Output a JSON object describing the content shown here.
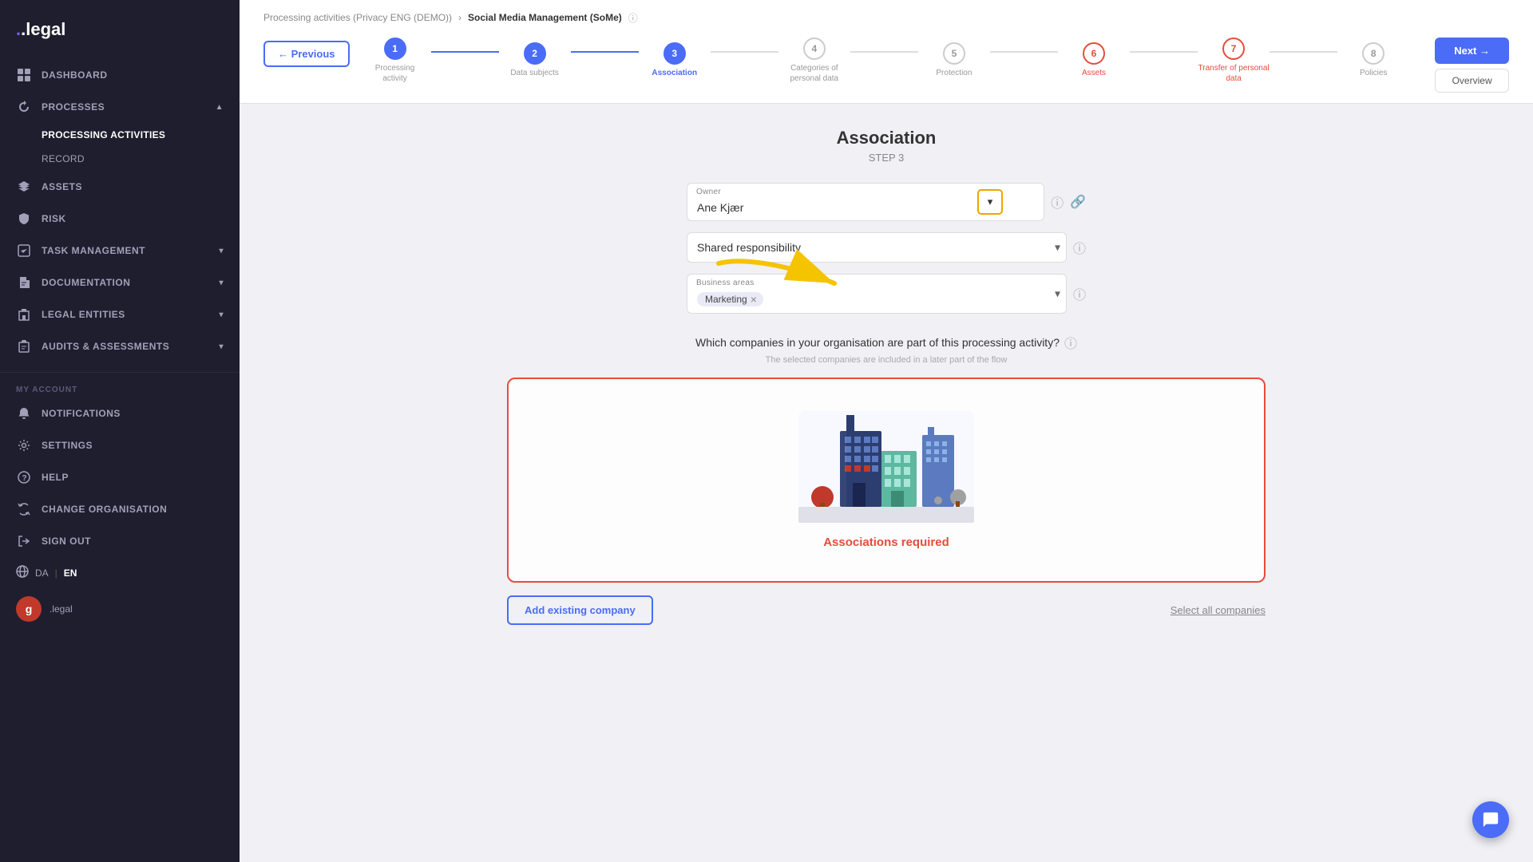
{
  "app": {
    "logo": ".legal",
    "logo_dot": "."
  },
  "sidebar": {
    "nav_items": [
      {
        "id": "dashboard",
        "label": "DASHBOARD",
        "icon": "grid"
      },
      {
        "id": "processes",
        "label": "PROCESSES",
        "icon": "refresh",
        "expanded": true
      },
      {
        "id": "processing-activities",
        "label": "PROCESSING ACTIVITIES",
        "active": true,
        "sub": true
      },
      {
        "id": "record",
        "label": "RECORD",
        "sub": true
      },
      {
        "id": "assets",
        "label": "ASSETS",
        "icon": "layers"
      },
      {
        "id": "risk",
        "label": "RISK",
        "icon": "shield"
      },
      {
        "id": "task-management",
        "label": "TASK MANAGEMENT",
        "icon": "check-square"
      },
      {
        "id": "documentation",
        "label": "DOCUMENTATION",
        "icon": "file-text"
      },
      {
        "id": "legal-entities",
        "label": "LEGAL ENTITIES",
        "icon": "building"
      },
      {
        "id": "audits-assessments",
        "label": "AUDITS & ASSESSMENTS",
        "icon": "clipboard"
      }
    ],
    "my_account_label": "MY ACCOUNT",
    "account_items": [
      {
        "id": "notifications",
        "label": "NOTIFICATIONS",
        "icon": "bell"
      },
      {
        "id": "settings",
        "label": "SETTINGS",
        "icon": "settings"
      },
      {
        "id": "help",
        "label": "HELP",
        "icon": "help-circle"
      },
      {
        "id": "change-organisation",
        "label": "CHANGE ORGANISATION",
        "icon": "refresh-cw"
      },
      {
        "id": "sign-out",
        "label": "SIGN OUT",
        "icon": "log-out"
      }
    ],
    "languages": [
      "DA",
      "EN"
    ],
    "active_lang": "EN",
    "avatar_letter": "g",
    "avatar_brand": ".legal"
  },
  "breadcrumb": {
    "parent": "Processing activities (Privacy ENG (DEMO))",
    "current": "Social Media Management (SoMe)",
    "info_icon": "ⓘ"
  },
  "steps": [
    {
      "num": "1",
      "label": "Processing activity",
      "state": "completed"
    },
    {
      "num": "2",
      "label": "Data subjects",
      "state": "completed"
    },
    {
      "num": "3",
      "label": "Association",
      "state": "active"
    },
    {
      "num": "4",
      "label": "Categories of personal data",
      "state": "default"
    },
    {
      "num": "5",
      "label": "Protection",
      "state": "default"
    },
    {
      "num": "6",
      "label": "Assets",
      "state": "warning"
    },
    {
      "num": "7",
      "label": "Transfer of personal data",
      "state": "warning"
    },
    {
      "num": "8",
      "label": "Policies",
      "state": "default"
    }
  ],
  "nav_buttons": {
    "prev": "← Previous",
    "next": "Next →",
    "overview": "Overview"
  },
  "page": {
    "title": "Association",
    "subtitle": "STEP 3"
  },
  "form": {
    "owner_label": "Owner",
    "owner_value": "Ane Kjær",
    "shared_responsibility_label": "Shared responsibility",
    "shared_responsibility_placeholder": "Shared responsibility",
    "business_areas_label": "Business areas",
    "business_areas_tag": "Marketing",
    "dropdown_icon": "▾",
    "info_icon": "ⓘ",
    "link_icon": "🔗"
  },
  "question": {
    "text": "Which companies in your organisation are part of this processing activity?",
    "hint": "The selected companies are included in a later part of the flow",
    "info_icon": "ⓘ"
  },
  "association_box": {
    "required_text": "Associations required"
  },
  "actions": {
    "add_company": "Add existing company",
    "select_all": "Select all companies"
  },
  "chat": {
    "icon": "💬"
  }
}
